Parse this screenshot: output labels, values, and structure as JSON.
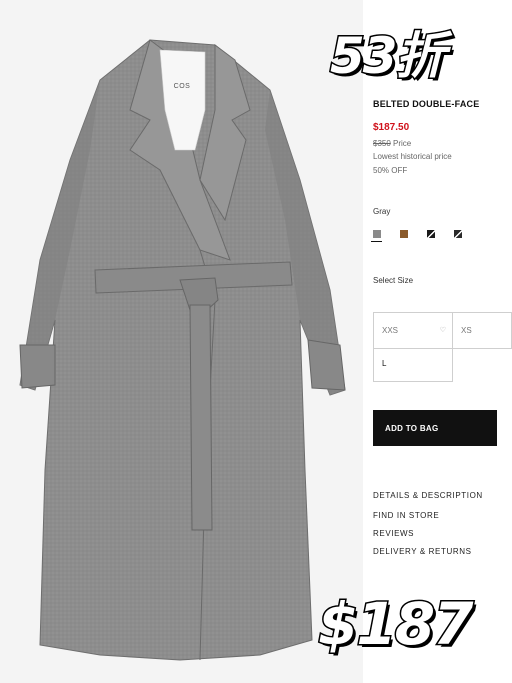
{
  "product": {
    "brand": "COS",
    "title": "BELTED DOUBLE-FACE",
    "sale_price": "$187.50",
    "original_price": "$350",
    "price_suffix": "Price",
    "price_note": "Lowest historical price",
    "discount": "50% OFF"
  },
  "color": {
    "label": "Gray",
    "swatches": [
      {
        "name": "gray",
        "color": "#8a8a8a"
      },
      {
        "name": "camel",
        "color": "#8a5a2b"
      },
      {
        "name": "black",
        "color": "#1a1a1a"
      },
      {
        "name": "black-2",
        "color": "#2a2a2a"
      }
    ]
  },
  "size": {
    "label": "Select Size",
    "options": [
      "XXS",
      "XS",
      "L"
    ]
  },
  "actions": {
    "add_to_bag": "ADD TO BAG"
  },
  "links": [
    "DETAILS & DESCRIPTION",
    "FIND IN STORE",
    "REVIEWS",
    "DELIVERY & RETURNS"
  ],
  "promo": {
    "discount_text": "53折",
    "price_text": "$187"
  },
  "colors": {
    "sale_red": "#d0121b",
    "button_black": "#111111"
  }
}
